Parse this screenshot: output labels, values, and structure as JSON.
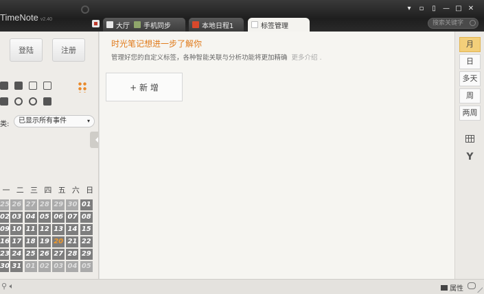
{
  "app": {
    "name": "TimeNote",
    "version": "v2.40"
  },
  "tabs": [
    {
      "label": "大厅"
    },
    {
      "label": "手机同步"
    },
    {
      "label": "本地日程1"
    },
    {
      "label": "标签管理"
    }
  ],
  "window_controls": {
    "minimize": "—",
    "maximize": "□",
    "close": "✕"
  },
  "search": {
    "placeholder": "搜索关键字"
  },
  "sidebar": {
    "login": "登陆",
    "register": "注册",
    "filter_label": "类:",
    "filter_value": "已显示所有事件",
    "weekdays": [
      "一",
      "二",
      "三",
      "四",
      "五",
      "六",
      "日"
    ],
    "calendar": [
      [
        "25",
        "26",
        "27",
        "28",
        "29",
        "30",
        "01"
      ],
      [
        "02",
        "03",
        "04",
        "05",
        "06",
        "07",
        "08"
      ],
      [
        "09",
        "10",
        "11",
        "12",
        "13",
        "14",
        "15"
      ],
      [
        "16",
        "17",
        "18",
        "19",
        "20",
        "21",
        "22"
      ],
      [
        "23",
        "24",
        "25",
        "26",
        "27",
        "28",
        "29"
      ],
      [
        "30",
        "31",
        "01",
        "02",
        "03",
        "04",
        "05"
      ]
    ]
  },
  "main": {
    "hint_title": "时光笔记想进一步了解你",
    "hint_desc": "管理好您的自定义标签，各种智能关联与分析功能将更加精确",
    "hint_more": "更多介绍 .",
    "add_button": "+ 新 增"
  },
  "view_modes": [
    "月",
    "日",
    "多天",
    "周",
    "两周"
  ],
  "statusbar": {
    "properties": "属性"
  },
  "colors": {
    "accent": "#e07a1a",
    "active_view": "#f3cf7a",
    "titlebar": "#2a2a2a"
  }
}
